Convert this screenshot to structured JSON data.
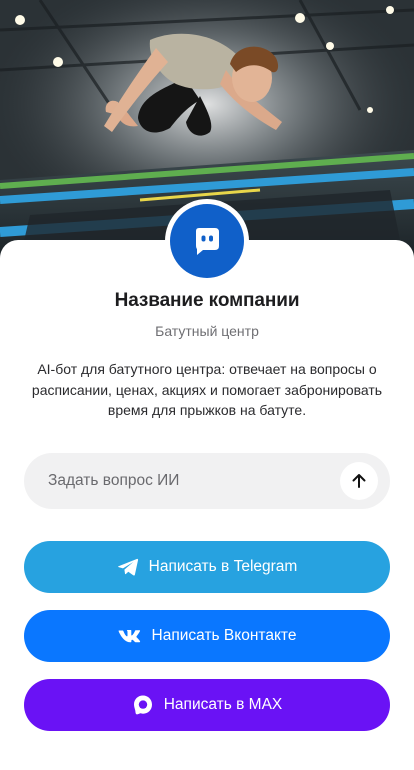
{
  "hero": {
    "image": "trampoline-jump-photo"
  },
  "company": {
    "avatar_icon": "chat-bot-icon",
    "name": "Название компании",
    "subtitle": "Батутный центр",
    "description": "AI-бот для батутного центра: отвечает на вопросы о расписании, ценах, акциях и помогает забронировать время для прыжков на батуте."
  },
  "ask": {
    "placeholder": "Задать вопрос ИИ",
    "value": "",
    "send_icon": "arrow-up-icon"
  },
  "buttons": {
    "telegram": {
      "label": "Написать в Telegram",
      "icon": "telegram-icon",
      "color": "#27a2e0"
    },
    "vk": {
      "label": "Написать Вконтакте",
      "icon": "vk-icon",
      "color": "#0a77ff"
    },
    "max": {
      "label": "Написать в MAX",
      "icon": "max-icon",
      "color": "#6a12f5"
    }
  },
  "colors": {
    "avatar": "#1060c9",
    "ask_bg": "#f1f1f2"
  }
}
